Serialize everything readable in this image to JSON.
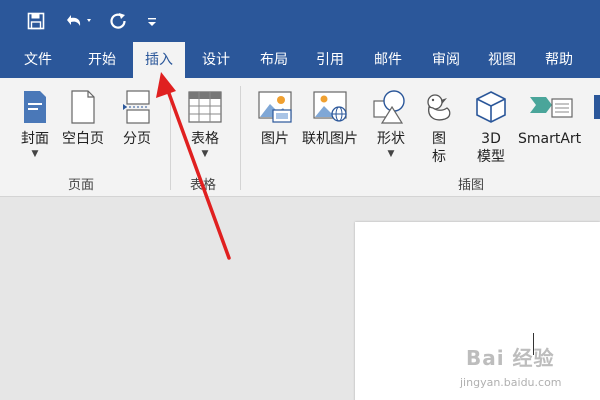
{
  "quick_access": {
    "save_icon": "save-icon",
    "undo_icon": "undo-icon",
    "redo_icon": "redo-icon",
    "customize_icon": "customize-icon"
  },
  "tabs": [
    {
      "label": "文件"
    },
    {
      "label": "开始"
    },
    {
      "label": "插入"
    },
    {
      "label": "设计"
    },
    {
      "label": "布局"
    },
    {
      "label": "引用"
    },
    {
      "label": "邮件"
    },
    {
      "label": "审阅"
    },
    {
      "label": "视图"
    },
    {
      "label": "帮助"
    }
  ],
  "ribbon": {
    "pages_group": {
      "label": "页面",
      "cover": "封面",
      "blank_page": "空白页",
      "page_break": "分页"
    },
    "tables_group": {
      "label": "表格",
      "table": "表格"
    },
    "illustrations_group": {
      "label": "插图",
      "pictures": "图片",
      "online_pictures": "联机图片",
      "shapes": "形状",
      "icons_line1": "图",
      "icons_line2": "标",
      "models_line1": "3D",
      "models_line2": "模型",
      "smartart": "SmartArt"
    }
  },
  "watermark": {
    "main": "Bai 经验",
    "sub": "jingyan.baidu.com"
  },
  "colors": {
    "accent": "#2b579a",
    "ribbon_bg": "#f3f3f3",
    "annotation_arrow": "#e02020"
  }
}
